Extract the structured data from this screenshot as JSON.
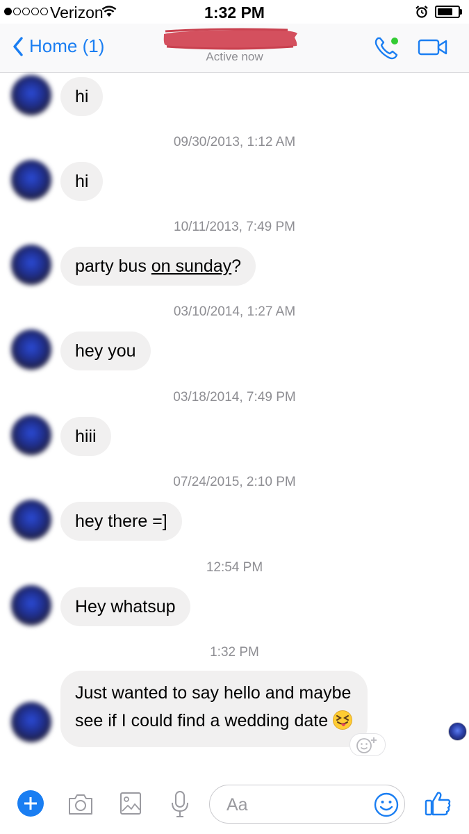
{
  "status_bar": {
    "carrier": "Verizon",
    "time": "1:32 PM",
    "signal_bars_filled": 1,
    "signal_bars_total": 5,
    "battery_level": 0.75
  },
  "header": {
    "back_label": "Home (1)",
    "active_status": "Active now",
    "icons": [
      "back-chevron-icon",
      "phone-call-icon",
      "video-camera-icon"
    ],
    "accent_color": "#1a7ef2",
    "online_color": "#33cc33"
  },
  "messages": [
    {
      "text": "hi"
    },
    {
      "timestamp": "09/30/2013, 1:12 AM",
      "text": "hi"
    },
    {
      "timestamp": "10/11/2013, 7:49 PM",
      "text_before": "party bus ",
      "text_link": "on sunday",
      "text_after": "?"
    },
    {
      "timestamp": "03/10/2014, 1:27 AM",
      "text": "hey you"
    },
    {
      "timestamp": "03/18/2014, 7:49 PM",
      "text": "hiii"
    },
    {
      "timestamp": "07/24/2015, 2:10 PM",
      "text": "hey there =]"
    },
    {
      "timestamp": "12:54 PM",
      "text": "Hey whatsup"
    },
    {
      "timestamp": "1:32 PM",
      "line1": "Just wanted to say hello and maybe",
      "line2": "see if I could find a wedding date"
    }
  ],
  "composer": {
    "placeholder": "Aa",
    "icons": [
      "plus-icon",
      "camera-icon",
      "image-icon",
      "microphone-icon",
      "emoji-icon",
      "thumbs-up-icon"
    ]
  },
  "colors": {
    "bubble_incoming": "#f1f0f0",
    "timestamp": "#8e8e93"
  }
}
